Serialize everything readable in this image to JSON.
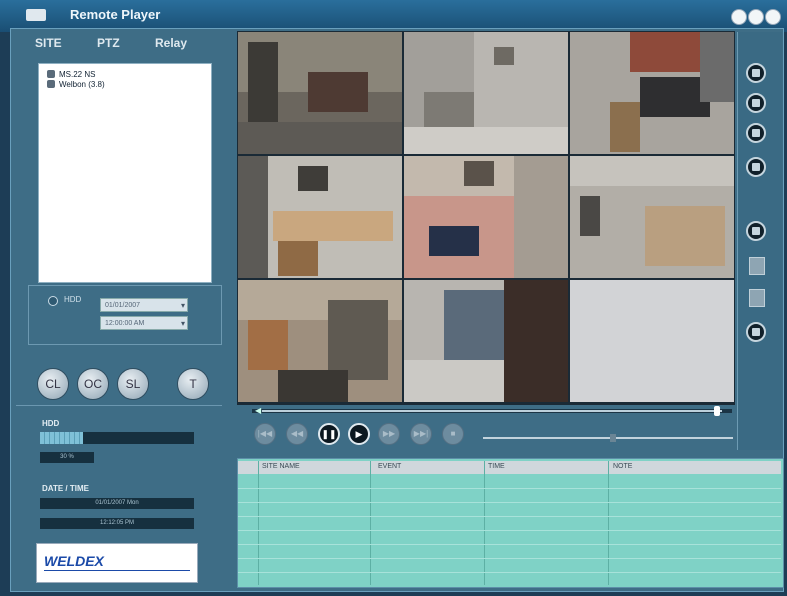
{
  "window": {
    "title": "Remote Player"
  },
  "tabs": [
    {
      "label": "SITE"
    },
    {
      "label": "PTZ"
    },
    {
      "label": "Relay"
    }
  ],
  "tree": {
    "items": [
      {
        "label": "MS.22 NS"
      },
      {
        "label": "Welbon (3.8)"
      }
    ]
  },
  "sub": {
    "radio_label": "HDD",
    "select1": "01/01/2007",
    "select2": "12:00:00 AM"
  },
  "round_buttons": [
    {
      "label": "CL"
    },
    {
      "label": "OC"
    },
    {
      "label": "SL"
    },
    {
      "label": "T"
    }
  ],
  "status": {
    "hdd_label": "HDD",
    "hdd_value": "30 %",
    "hdd_usage_fraction": 0.28,
    "datetime_label": "DATE / TIME",
    "date_value": "01/01/2007 Mon",
    "time_value": "12:12:05 PM"
  },
  "logo": {
    "text": "WELDEX"
  },
  "playback": {
    "buttons": [
      {
        "label": "|◀◀"
      },
      {
        "label": "◀◀"
      },
      {
        "label": "❚❚"
      },
      {
        "label": "▶"
      },
      {
        "label": "▶▶"
      },
      {
        "label": "▶▶|"
      },
      {
        "label": "■"
      }
    ],
    "seek_fraction": 0.99,
    "speed_fraction": 0.52
  },
  "list": {
    "columns": [
      "SITE NAME",
      "EVENT",
      "TIME",
      "NOTE"
    ]
  },
  "colors": {
    "accent": "#2a6f9c",
    "panel": "#3e6d86",
    "list_bg": "#7fd2c6"
  }
}
